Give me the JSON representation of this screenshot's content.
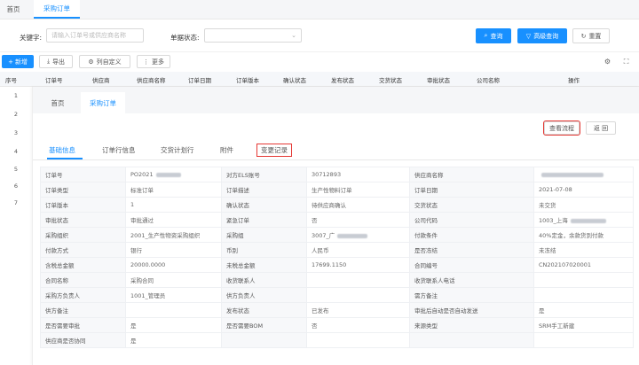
{
  "top_tabs": [
    {
      "label": "首页"
    },
    {
      "label": "采购订单"
    }
  ],
  "filters": {
    "keyword_label": "关键字:",
    "keyword_placeholder": "请输入订单号或供应商名称",
    "status_label": "单据状态:",
    "status_value": "",
    "query_label": "查询",
    "advanced_label": "高级查询",
    "reset_label": "重置"
  },
  "toolbar": {
    "new_label": "新增",
    "export_label": "导出",
    "columns_label": "列自定义",
    "more_label": "更多"
  },
  "main_table": {
    "headers": [
      "序号",
      "订单号",
      "供应商",
      "供应商名称",
      "订单日期",
      "订单版本",
      "确认状态",
      "发布状态",
      "交货状态",
      "审批状态",
      "公司名称",
      "操作"
    ],
    "row_numbers": [
      "1",
      "2",
      "3",
      "4",
      "5",
      "6",
      "7"
    ]
  },
  "panel": {
    "tabs": [
      {
        "label": "首页"
      },
      {
        "label": "采购订单"
      }
    ],
    "view_flow_label": "查看流程",
    "back_label": "返 回",
    "sub_tabs": [
      {
        "label": "基础信息"
      },
      {
        "label": "订单行信息"
      },
      {
        "label": "交货计划行"
      },
      {
        "label": "附件"
      },
      {
        "label": "变更记录"
      }
    ],
    "details": [
      {
        "k1": "订单号",
        "v1": "PO2021",
        "k2": "对方ELS账号",
        "v2": "30712893",
        "k3": "供应商名称",
        "v3": ""
      },
      {
        "k1": "订单类型",
        "v1": "标准订单",
        "k2": "订单描述",
        "v2": "生产性物料订单",
        "k3": "订单日期",
        "v3": "2021-07-08"
      },
      {
        "k1": "订单版本",
        "v1": "1",
        "k2": "确认状态",
        "v2": "待供应商确认",
        "k3": "交货状态",
        "v3": "未交货"
      },
      {
        "k1": "审批状态",
        "v1": "审批通过",
        "k2": "紧急订单",
        "v2": "否",
        "k3": "公司代码",
        "v3": "1003_上海"
      },
      {
        "k1": "采购组织",
        "v1": "2001_生产性物资采购组织",
        "k2": "采购组",
        "v2": "3007_广",
        "k3": "付款条件",
        "v3": "40%定金，余款货到付款"
      },
      {
        "k1": "付款方式",
        "v1": "银行",
        "k2": "币别",
        "v2": "人民币",
        "k3": "是否冻结",
        "v3": "未冻结"
      },
      {
        "k1": "含税总金额",
        "v1": "20000.0000",
        "k2": "未税总金额",
        "v2": "17699.1150",
        "k3": "合同编号",
        "v3": "CN202107020001"
      },
      {
        "k1": "合同名称",
        "v1": "采购合同",
        "k2": "收货联系人",
        "v2": "",
        "k3": "收货联系人电话",
        "v3": ""
      },
      {
        "k1": "采购方负责人",
        "v1": "1001_管理员",
        "k2": "供方负责人",
        "v2": "",
        "k3": "需方备注",
        "v3": ""
      },
      {
        "k1": "供方备注",
        "v1": "",
        "k2": "发布状态",
        "v2": "已发布",
        "k3": "审批后自动是否自动发送",
        "v3": "是"
      },
      {
        "k1": "是否需要审批",
        "v1": "是",
        "k2": "是否需要BOM",
        "v2": "否",
        "k3": "来源类型",
        "v3": "SRM手工新建"
      },
      {
        "k1": "供应商是否协同",
        "v1": "是",
        "k2": "",
        "v2": "",
        "k3": "",
        "v3": ""
      }
    ]
  },
  "colors": {
    "primary": "#1890ff",
    "highlight_border": "#e53935"
  }
}
